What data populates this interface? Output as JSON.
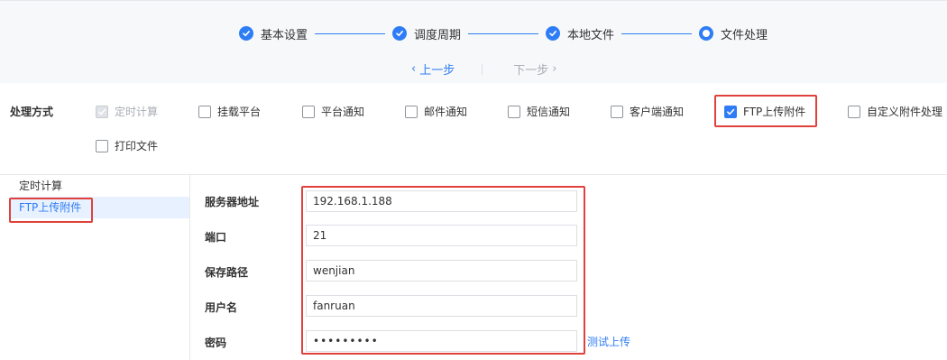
{
  "wizard": {
    "steps": [
      {
        "label": "基本设置",
        "state": "done"
      },
      {
        "label": "调度周期",
        "state": "done"
      },
      {
        "label": "本地文件",
        "state": "done"
      },
      {
        "label": "文件处理",
        "state": "current"
      }
    ],
    "prev_label": "上一步",
    "next_label": "下一步"
  },
  "mode": {
    "title": "处理方式",
    "options": [
      {
        "label": "定时计算",
        "checked": true,
        "disabled": true
      },
      {
        "label": "挂载平台",
        "checked": false
      },
      {
        "label": "平台通知",
        "checked": false
      },
      {
        "label": "邮件通知",
        "checked": false
      },
      {
        "label": "短信通知",
        "checked": false
      },
      {
        "label": "客户端通知",
        "checked": false
      },
      {
        "label": "FTP上传附件",
        "checked": true
      },
      {
        "label": "自定义附件处理",
        "checked": false
      },
      {
        "label": "打印文件",
        "checked": false
      }
    ]
  },
  "left_list": {
    "items": [
      {
        "label": "定时计算"
      },
      {
        "label": "FTP上传附件",
        "active": true
      }
    ]
  },
  "form": {
    "server_label": "服务器地址",
    "server_value": "192.168.1.188",
    "port_label": "端口",
    "port_value": "21",
    "path_label": "保存路径",
    "path_value": "wenjian",
    "user_label": "用户名",
    "user_value": "fanruan",
    "password_label": "密码",
    "password_value": "•••••••••",
    "test_upload": "测试上传"
  },
  "colors": {
    "accent": "#2f7df6",
    "highlight": "#e0413c"
  }
}
